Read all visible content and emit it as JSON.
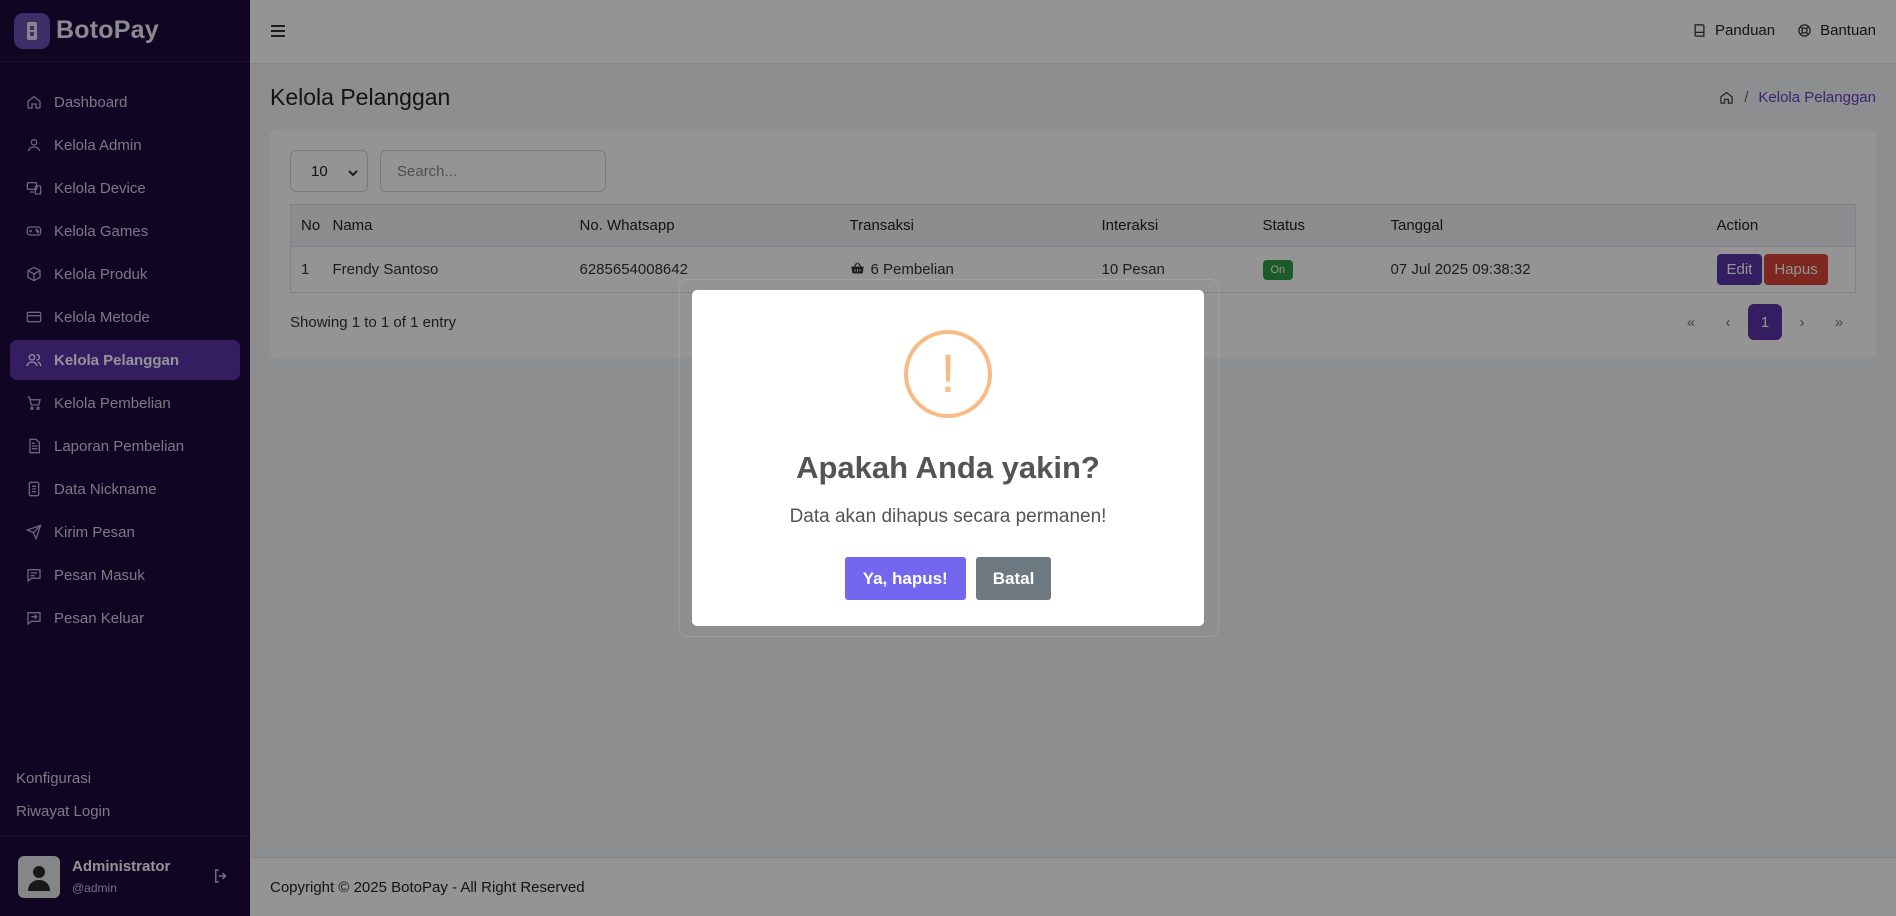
{
  "brand": {
    "name": "BotoPay"
  },
  "sidebar": {
    "items": [
      {
        "label": "Dashboard",
        "icon": "home-icon"
      },
      {
        "label": "Kelola Admin",
        "icon": "user-icon"
      },
      {
        "label": "Kelola Device",
        "icon": "devices-icon"
      },
      {
        "label": "Kelola Games",
        "icon": "gamepad-icon"
      },
      {
        "label": "Kelola Produk",
        "icon": "box-icon"
      },
      {
        "label": "Kelola Metode",
        "icon": "credit-card-icon"
      },
      {
        "label": "Kelola Pelanggan",
        "icon": "users-icon",
        "active": true
      },
      {
        "label": "Kelola Pembelian",
        "icon": "cart-icon"
      },
      {
        "label": "Laporan Pembelian",
        "icon": "report-icon"
      },
      {
        "label": "Data Nickname",
        "icon": "file-icon"
      },
      {
        "label": "Kirim Pesan",
        "icon": "send-icon"
      },
      {
        "label": "Pesan Masuk",
        "icon": "message-icon"
      },
      {
        "label": "Pesan Keluar",
        "icon": "message-out-icon"
      }
    ],
    "bottom": [
      "Konfigurasi",
      "Riwayat Login"
    ],
    "user": {
      "name": "Administrator",
      "handle": "@admin"
    }
  },
  "topbar": {
    "links": [
      "Panduan",
      "Bantuan"
    ]
  },
  "page": {
    "title": "Kelola Pelanggan",
    "breadcrumb": "Kelola Pelanggan",
    "breadcrumb_sep": "/"
  },
  "table_controls": {
    "page_size": "10",
    "search_placeholder": "Search..."
  },
  "table": {
    "headers": [
      "No",
      "Nama",
      "No. Whatsapp",
      "Transaksi",
      "Interaksi",
      "Status",
      "Tanggal",
      "Action"
    ],
    "rows": [
      {
        "no": "1",
        "nama": "Frendy Santoso",
        "whatsapp": "6285654008642",
        "transaksi": "6 Pembelian",
        "interaksi": "10 Pesan",
        "status": "On",
        "tanggal": "07 Jul 2025 09:38:32",
        "edit": "Edit",
        "hapus": "Hapus"
      }
    ]
  },
  "pagination": {
    "showing": "Showing 1 to 1 of 1 entry",
    "first": "«",
    "prev": "‹",
    "current": "1",
    "next": "›",
    "last": "»"
  },
  "footer": {
    "text": "Copyright © 2025 BotoPay - All Right Reserved"
  },
  "modal": {
    "icon": "!",
    "title": "Apakah Anda yakin?",
    "text": "Data akan dihapus secara permanen!",
    "confirm": "Ya, hapus!",
    "cancel": "Batal"
  },
  "colors": {
    "sidebar_bg": "#1c0a3c",
    "accent": "#5b32a8",
    "confirm": "#7367f0",
    "cancel": "#6e7881",
    "danger": "#d9443a",
    "success": "#2f9e44",
    "warning": "#f8bb86"
  }
}
